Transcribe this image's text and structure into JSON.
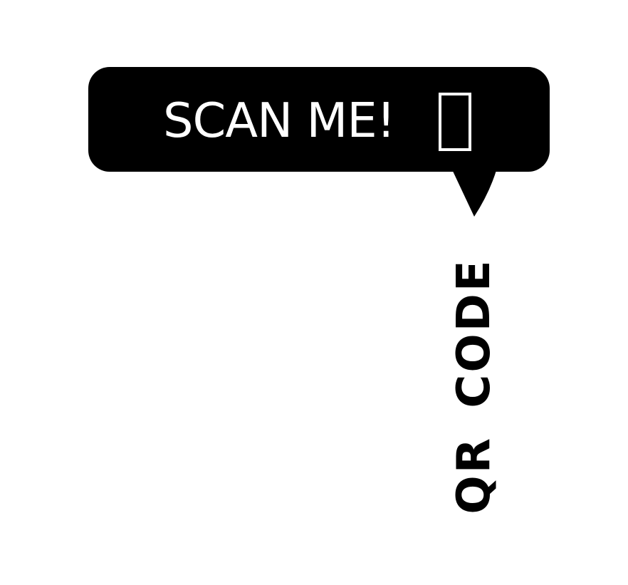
{
  "bubble": {
    "text": "SCAN ME!",
    "icon": "phone-outline-icon",
    "background": "#000000",
    "text_color": "#ffffff"
  },
  "label": {
    "text": "QR CODE",
    "color": "#000000",
    "orientation": "vertical"
  }
}
